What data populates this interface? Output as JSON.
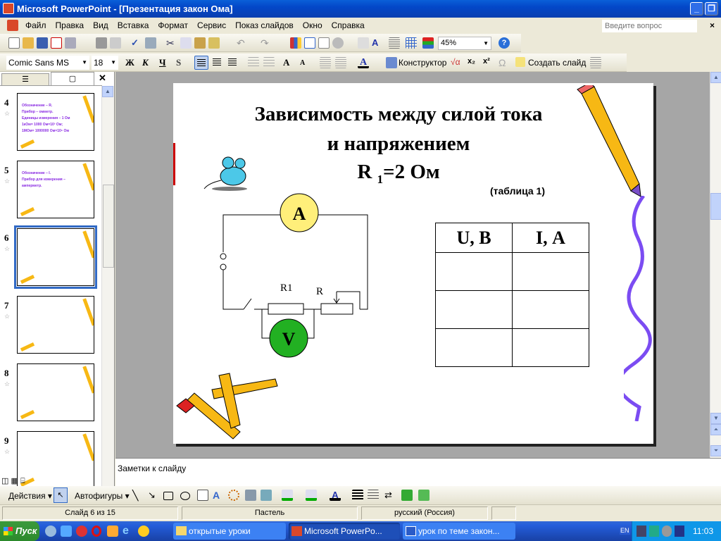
{
  "window": {
    "title": "Microsoft PowerPoint - [Презентация закон Ома]",
    "help_placeholder": "Введите вопрос"
  },
  "menu": [
    "Файл",
    "Правка",
    "Вид",
    "Вставка",
    "Формат",
    "Сервис",
    "Показ слайдов",
    "Окно",
    "Справка"
  ],
  "toolbar": {
    "zoom": "45%",
    "font": "Comic Sans MS",
    "size": "18",
    "bold": "Ж",
    "italic": "К",
    "underline": "Ч",
    "shadow": "S",
    "designer": "Конструктор",
    "new_slide": "Создать слайд"
  },
  "slides_pane": {
    "thumbnails": [
      {
        "num": "4",
        "lines": [
          "Обозначение – R.",
          "Прибор – омметр.",
          "Единицы измерения – 1 Ом",
          "1кОм= 1000 Ом=10³ Ом;",
          "1МОм= 1000000 Ом=10⁶ Ом"
        ]
      },
      {
        "num": "5",
        "lines": [
          "Обозначение – I.",
          "Прибор для измерения –",
          "амперметр."
        ]
      },
      {
        "num": "6",
        "lines": [],
        "selected": true
      },
      {
        "num": "7",
        "lines": []
      },
      {
        "num": "8",
        "lines": []
      },
      {
        "num": "9",
        "lines": []
      }
    ]
  },
  "slide": {
    "title_line1": "Зависимость между силой тока",
    "title_line2": "и напряжением",
    "r_label": "R",
    "r_sub": "1",
    "r_value": "=2 Ом",
    "table_caption": "(таблица 1)",
    "table_headers": [
      "U, В",
      "I, А"
    ],
    "table_rows": [
      [
        "",
        ""
      ],
      [
        "",
        ""
      ],
      [
        "",
        ""
      ]
    ],
    "ammeter": "A",
    "voltmeter": "V",
    "resistor1": "R1",
    "rheostat": "R"
  },
  "notes": {
    "placeholder": "Заметки к слайду"
  },
  "drawing": {
    "actions": "Действия",
    "autoshapes": "Автофигуры"
  },
  "status": {
    "slide": "Слайд 6 из 15",
    "design": "Пастель",
    "language": "русский (Россия)"
  },
  "taskbar": {
    "start": "Пуск",
    "tasks": [
      "открытые уроки",
      "Microsoft PowerPo...",
      "урок по теме закон..."
    ],
    "lang": "EN",
    "clock": "11:03"
  },
  "colors": {
    "ammeter": "#ffef7a",
    "voltmeter": "#22b022",
    "selection": "#316ac5"
  }
}
